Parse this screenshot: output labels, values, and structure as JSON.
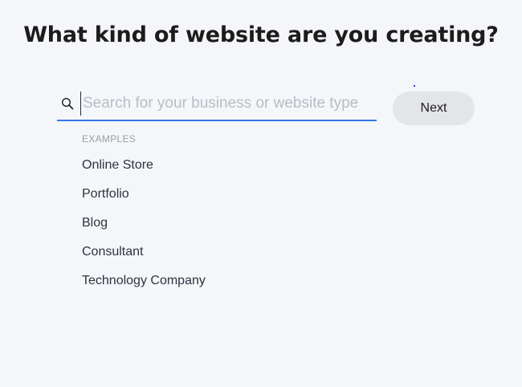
{
  "page": {
    "title": "What kind of website are you creating?"
  },
  "search": {
    "placeholder": "Search for your business or website type",
    "value": "",
    "icon": "search-icon"
  },
  "next_button": {
    "label": "Next"
  },
  "examples": {
    "label": "EXAMPLES",
    "items": [
      {
        "label": "Online Store"
      },
      {
        "label": "Portfolio"
      },
      {
        "label": "Blog"
      },
      {
        "label": "Consultant"
      },
      {
        "label": "Technology Company"
      }
    ]
  },
  "colors": {
    "accent": "#3079e6",
    "background": "#f4f6f9",
    "button_bg": "#e3e5e9"
  }
}
